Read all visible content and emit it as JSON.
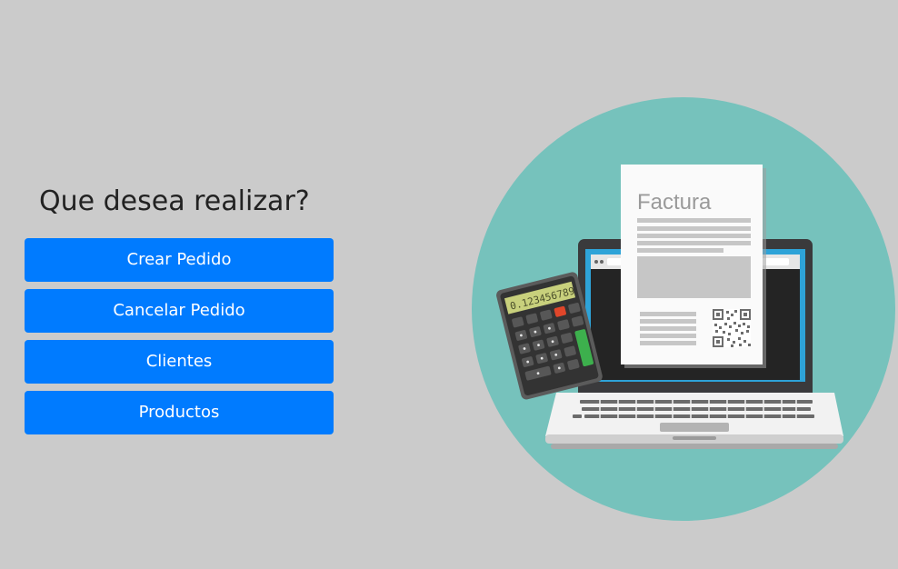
{
  "menu": {
    "title": "Que desea realizar?",
    "buttons": [
      {
        "label": "Crear Pedido"
      },
      {
        "label": "Cancelar Pedido"
      },
      {
        "label": "Clientes"
      },
      {
        "label": "Productos"
      }
    ]
  },
  "illustration": {
    "invoice_title": "Factura",
    "calculator_display": "0.123456789",
    "colors": {
      "background": "#cbcbcb",
      "button": "#007bff",
      "circle": "#76c2bc",
      "screen_frame": "#2ea3d8",
      "calculator_key_red": "#e0462a",
      "calculator_key_green": "#3db04d"
    }
  }
}
